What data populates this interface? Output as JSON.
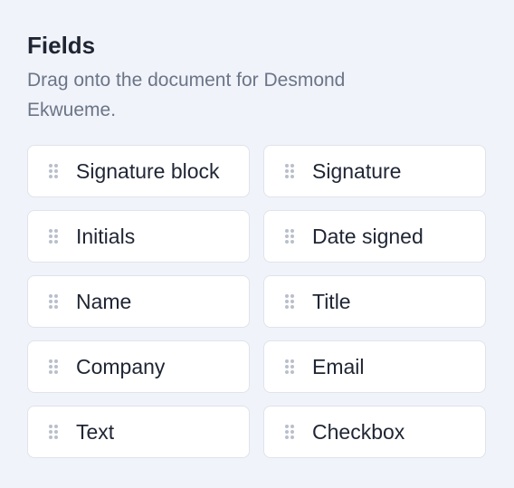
{
  "panel": {
    "title": "Fields",
    "subtitle": "Drag onto the document for Desmond Ekwueme."
  },
  "fields": [
    {
      "label": "Signature block",
      "icon": "drag-handle-icon"
    },
    {
      "label": "Signature",
      "icon": "drag-handle-icon"
    },
    {
      "label": "Initials",
      "icon": "drag-handle-icon"
    },
    {
      "label": "Date signed",
      "icon": "drag-handle-icon"
    },
    {
      "label": "Name",
      "icon": "drag-handle-icon"
    },
    {
      "label": "Title",
      "icon": "drag-handle-icon"
    },
    {
      "label": "Company",
      "icon": "drag-handle-icon"
    },
    {
      "label": "Email",
      "icon": "drag-handle-icon"
    },
    {
      "label": "Text",
      "icon": "drag-handle-icon"
    },
    {
      "label": "Checkbox",
      "icon": "drag-handle-icon"
    }
  ],
  "colors": {
    "background": "#f1f3fa",
    "title": "#1f2533",
    "subtitle": "#6b7587",
    "card_border": "#dfe3eb",
    "grip": "#b9bfca"
  }
}
